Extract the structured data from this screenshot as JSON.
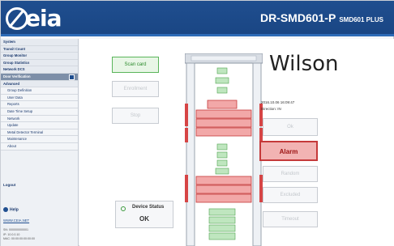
{
  "header": {
    "logo_text": "eia",
    "model": "DR-SMD601-P",
    "model_sub": "SMD601 PLUS"
  },
  "sidebar": {
    "items": [
      {
        "label": "System"
      },
      {
        "label": "Transit Count"
      },
      {
        "label": "Group Monitor"
      },
      {
        "label": "Group Statistics"
      },
      {
        "label": "Network DCS"
      },
      {
        "label": "Door Verification"
      },
      {
        "label": "Advanced"
      }
    ],
    "subitems": [
      {
        "label": "Group Definition"
      },
      {
        "label": "User Data"
      },
      {
        "label": "Reports"
      },
      {
        "label": "Date Time Setup"
      },
      {
        "label": "Network"
      },
      {
        "label": "Update"
      },
      {
        "label": "Metal Detector Terminal"
      },
      {
        "label": "Maintenance"
      },
      {
        "label": "About"
      }
    ],
    "logout": "Logout",
    "help": "Help",
    "site": "WWW.CEIA.NET",
    "info_lines": [
      "SN: 000000000001",
      "IP: 10.0.0.10",
      "MAC: 00:00:00:00:00:00"
    ]
  },
  "main": {
    "scan_card": "Scan card",
    "enrollment": "Enrollment",
    "stop": "Stop",
    "device_status_label": "Device Status",
    "device_status_value": "OK",
    "person_name": "Wilson",
    "datetime": "2016.10.06 16:09:47",
    "direction": "Direction: IN",
    "ok": "Ok",
    "alarm": "Alarm",
    "r3": "Random",
    "r4": "Excluded",
    "r5": "Timeout"
  },
  "colors": {
    "brand": "#1f4e8f",
    "alarm": "#c5393a",
    "alarm_fill": "#f2b3b3",
    "ok_green": "#3c9a3c"
  },
  "gate_zone_levels": {
    "left_pillar_alarm_zones": 3,
    "right_pillar_alarm_zones": 3
  }
}
